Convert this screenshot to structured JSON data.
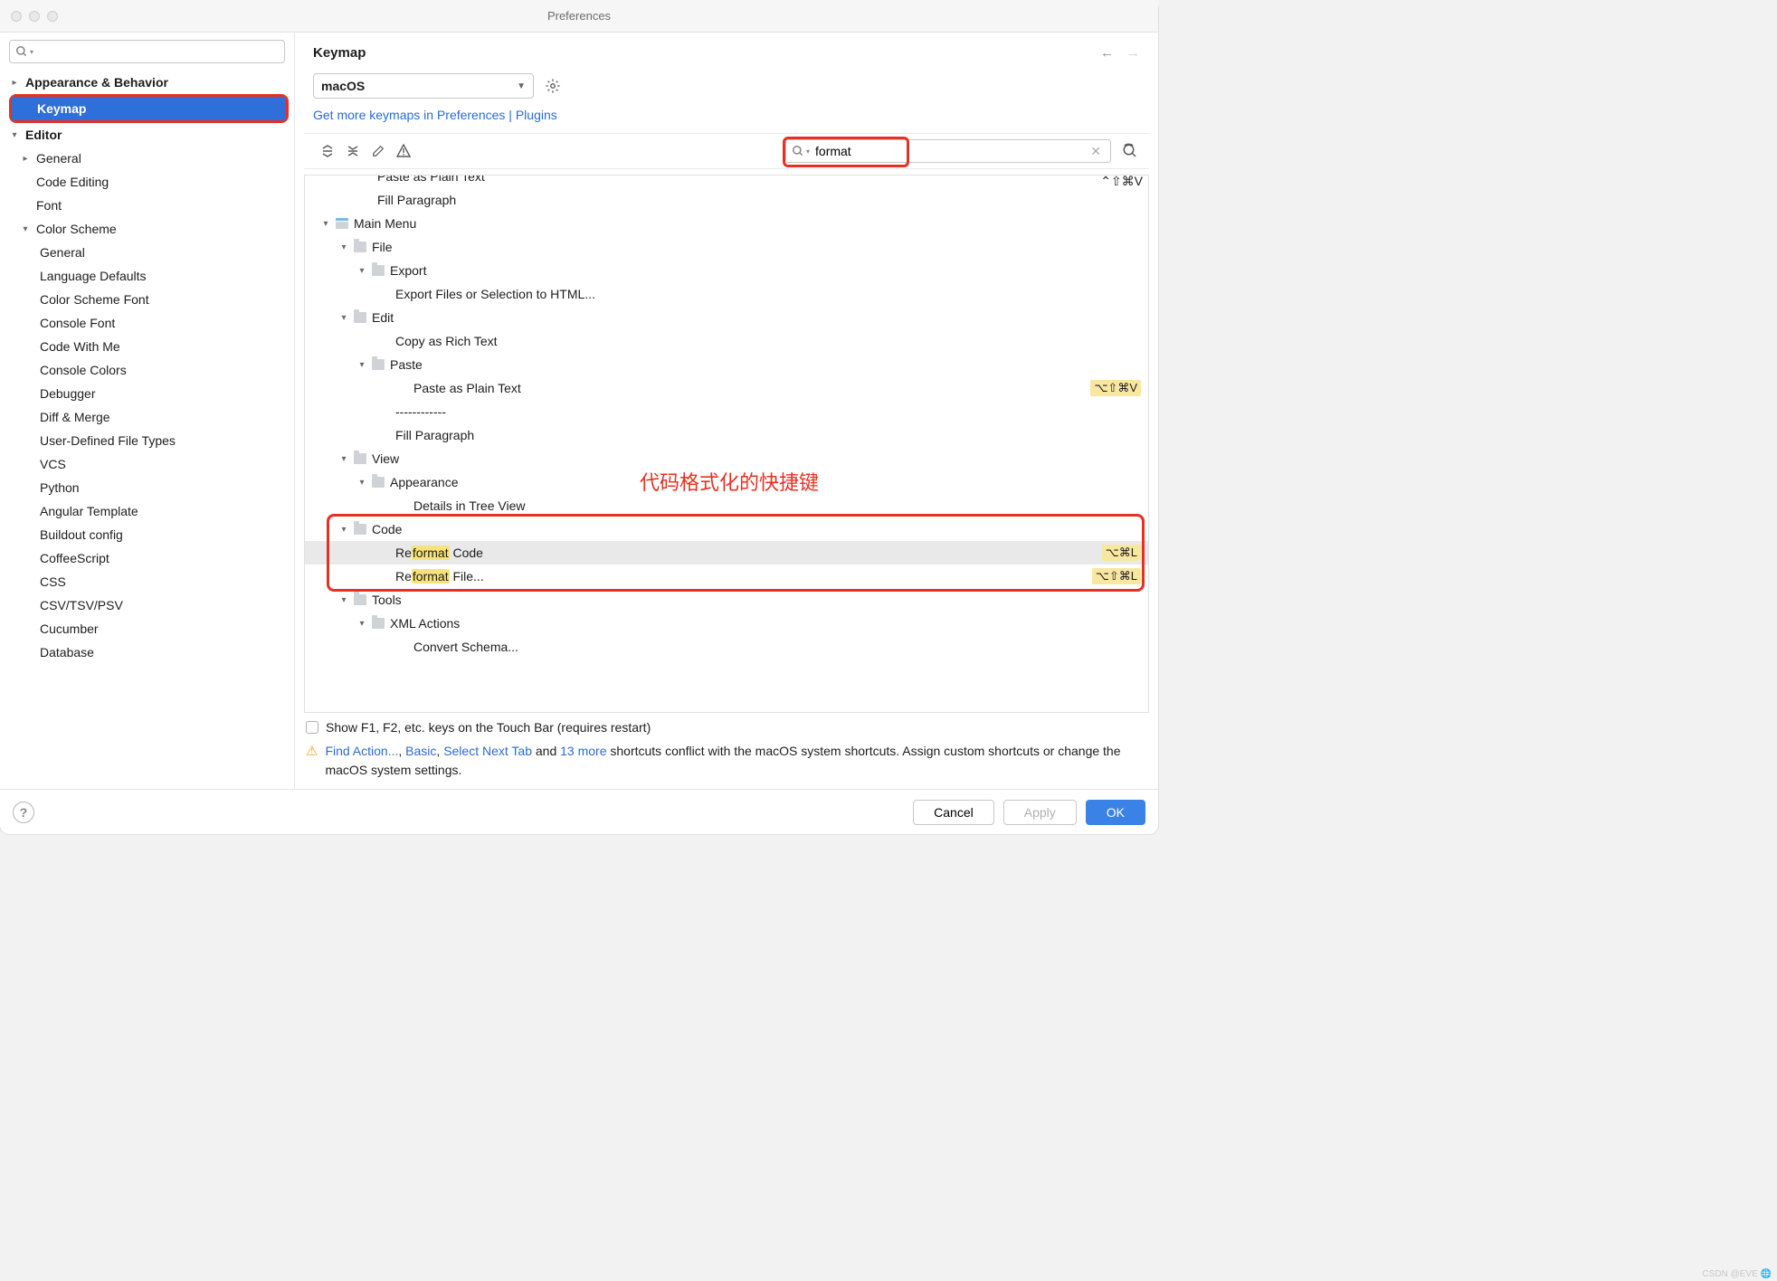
{
  "window": {
    "title": "Preferences"
  },
  "sidebar": {
    "search_placeholder": "",
    "items": [
      {
        "label": "Appearance & Behavior",
        "level": 0,
        "expand": "right",
        "bold": true
      },
      {
        "label": "Keymap",
        "level": 0,
        "bold": true,
        "selected": true,
        "highlighted": true
      },
      {
        "label": "Editor",
        "level": 0,
        "expand": "down",
        "bold": true
      },
      {
        "label": "General",
        "level": 1,
        "expand": "right"
      },
      {
        "label": "Code Editing",
        "level": 1
      },
      {
        "label": "Font",
        "level": 1
      },
      {
        "label": "Color Scheme",
        "level": 1,
        "expand": "down"
      },
      {
        "label": "General",
        "level": 2
      },
      {
        "label": "Language Defaults",
        "level": 2
      },
      {
        "label": "Color Scheme Font",
        "level": 2
      },
      {
        "label": "Console Font",
        "level": 2
      },
      {
        "label": "Code With Me",
        "level": 2
      },
      {
        "label": "Console Colors",
        "level": 2
      },
      {
        "label": "Debugger",
        "level": 2
      },
      {
        "label": "Diff & Merge",
        "level": 2
      },
      {
        "label": "User-Defined File Types",
        "level": 2
      },
      {
        "label": "VCS",
        "level": 2
      },
      {
        "label": "Python",
        "level": 2
      },
      {
        "label": "Angular Template",
        "level": 2
      },
      {
        "label": "Buildout config",
        "level": 2
      },
      {
        "label": "CoffeeScript",
        "level": 2
      },
      {
        "label": "CSS",
        "level": 2
      },
      {
        "label": "CSV/TSV/PSV",
        "level": 2
      },
      {
        "label": "Cucumber",
        "level": 2
      },
      {
        "label": "Database",
        "level": 2
      }
    ]
  },
  "main": {
    "heading": "Keymap",
    "keymap_select": "macOS",
    "link": "Get more keymaps in Preferences | Plugins",
    "search_value": "format",
    "annotation": "代码格式化的快捷键",
    "topcut_short": "⌃⇧⌘V",
    "tree": [
      {
        "indent": 80,
        "label": "Paste as Plain Text",
        "cut": true
      },
      {
        "indent": 80,
        "label": "Fill Paragraph"
      },
      {
        "indent": 16,
        "chev": "down",
        "icon": "menu",
        "label": "Main Menu"
      },
      {
        "indent": 36,
        "chev": "down",
        "icon": "folder",
        "label": "File"
      },
      {
        "indent": 56,
        "chev": "down",
        "icon": "folder",
        "label": "Export"
      },
      {
        "indent": 100,
        "label": "Export Files or Selection to HTML..."
      },
      {
        "indent": 36,
        "chev": "down",
        "icon": "folder",
        "label": "Edit"
      },
      {
        "indent": 100,
        "label": "Copy as Rich Text"
      },
      {
        "indent": 56,
        "chev": "down",
        "icon": "folder",
        "label": "Paste"
      },
      {
        "indent": 120,
        "label": "Paste as Plain Text",
        "short": "⌥⇧⌘V"
      },
      {
        "indent": 100,
        "label": "------------"
      },
      {
        "indent": 100,
        "label": "Fill Paragraph"
      },
      {
        "indent": 36,
        "chev": "down",
        "icon": "folder",
        "label": "View"
      },
      {
        "indent": 56,
        "chev": "down",
        "icon": "folder",
        "label": "Appearance"
      },
      {
        "indent": 120,
        "label": "Details in Tree View"
      },
      {
        "indent": 36,
        "chev": "down",
        "icon": "folder",
        "label": "Code"
      },
      {
        "indent": 100,
        "label_pre": "Re",
        "label_hl": "format",
        "label_post": " Code",
        "short": "⌥⌘L",
        "selected": true
      },
      {
        "indent": 100,
        "label_pre": "Re",
        "label_hl": "format",
        "label_post": " File...",
        "short": "⌥⇧⌘L"
      },
      {
        "indent": 36,
        "chev": "down",
        "icon": "folder",
        "label": "Tools"
      },
      {
        "indent": 56,
        "chev": "down",
        "icon": "folder",
        "label": "XML Actions"
      },
      {
        "indent": 120,
        "label": "Convert Schema..."
      }
    ],
    "touchbar": "Show F1, F2, etc. keys on the Touch Bar (requires restart)",
    "conflict": {
      "a1": "Find Action...",
      "c1": ", ",
      "a2": "Basic",
      "c2": ", ",
      "a3": "Select Next Tab",
      "mid": " and ",
      "a4": "13 more",
      "tail": " shortcuts conflict with the macOS system shortcuts. Assign custom shortcuts or change the macOS system settings."
    }
  },
  "footer": {
    "cancel": "Cancel",
    "apply": "Apply",
    "ok": "OK"
  },
  "watermark": "CSDN @EVE 🌐"
}
